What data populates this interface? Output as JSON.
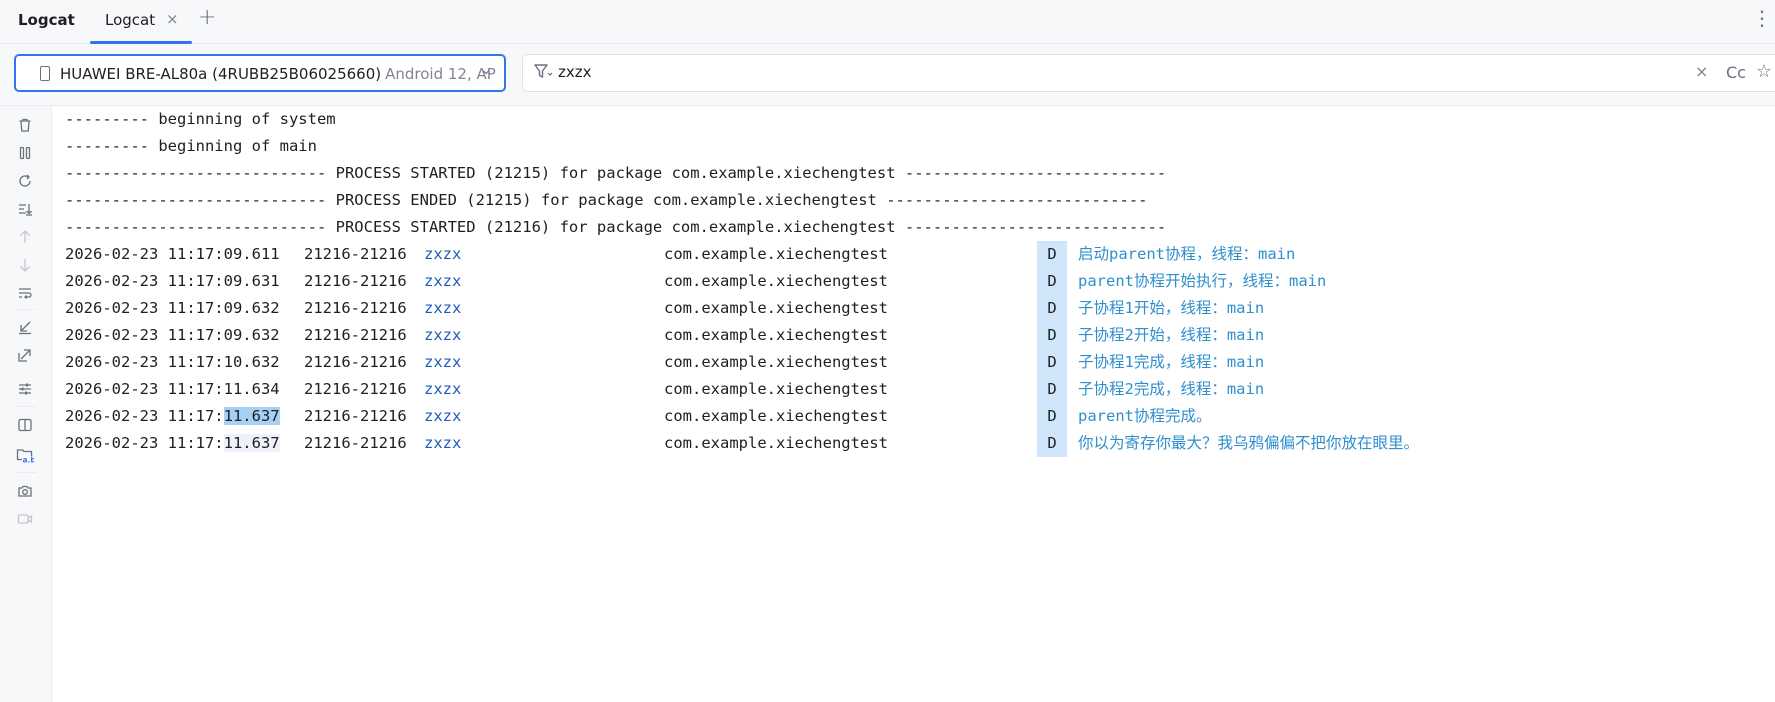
{
  "header": {
    "tool_title": "Logcat",
    "tab_label": "Logcat",
    "tab_close": "×",
    "add_tab": "+",
    "more_menu": "⋮"
  },
  "device": {
    "name": "HUAWEI BRE-AL80a (4RUBB25B06025660)",
    "os": "Android 12, AP",
    "chevron": "⌄"
  },
  "filter": {
    "value": "zxzx",
    "clear": "×",
    "case_label": "Cc",
    "star": "☆"
  },
  "sidebar": {
    "icons": [
      "trash-icon",
      "pause-icon",
      "restart-icon",
      "scroll-to-end-icon",
      "up-arrow-icon",
      "down-arrow-icon",
      "soft-wrap-icon",
      "import-icon",
      "export-icon",
      "settings-icon",
      "split-view-icon",
      "folder-regex-icon",
      "screenshot-icon",
      "screen-record-icon"
    ]
  },
  "log": {
    "headers": [
      "--------- beginning of system",
      "--------- beginning of main",
      "---------------------------- PROCESS STARTED (21215) for package com.example.xiechengtest ----------------------------",
      "---------------------------- PROCESS ENDED (21215) for package com.example.xiechengtest ----------------------------",
      "---------------------------- PROCESS STARTED (21216) for package com.example.xiechengtest ----------------------------"
    ],
    "entries": [
      {
        "ts_prefix": "2026-02-23 11:17:",
        "ts_suffix": "09.611",
        "pid": "21216-21216",
        "tag": "zxzx",
        "pkg": "com.example.xiechengtest",
        "level": "D",
        "msg": "启动parent协程，线程：main"
      },
      {
        "ts_prefix": "2026-02-23 11:17:",
        "ts_suffix": "09.631",
        "pid": "21216-21216",
        "tag": "zxzx",
        "pkg": "com.example.xiechengtest",
        "level": "D",
        "msg": "parent协程开始执行，线程：main"
      },
      {
        "ts_prefix": "2026-02-23 11:17:",
        "ts_suffix": "09.632",
        "pid": "21216-21216",
        "tag": "zxzx",
        "pkg": "com.example.xiechengtest",
        "level": "D",
        "msg": "子协程1开始，线程：main"
      },
      {
        "ts_prefix": "2026-02-23 11:17:",
        "ts_suffix": "09.632",
        "pid": "21216-21216",
        "tag": "zxzx",
        "pkg": "com.example.xiechengtest",
        "level": "D",
        "msg": "子协程2开始，线程：main"
      },
      {
        "ts_prefix": "2026-02-23 11:17:",
        "ts_suffix": "10.632",
        "pid": "21216-21216",
        "tag": "zxzx",
        "pkg": "com.example.xiechengtest",
        "level": "D",
        "msg": "子协程1完成，线程：main"
      },
      {
        "ts_prefix": "2026-02-23 11:17:",
        "ts_suffix": "11.634",
        "pid": "21216-21216",
        "tag": "zxzx",
        "pkg": "com.example.xiechengtest",
        "level": "D",
        "msg": "子协程2完成，线程：main"
      },
      {
        "ts_prefix": "2026-02-23 11:17:",
        "ts_suffix": "11.637",
        "pid": "21216-21216",
        "tag": "zxzx",
        "pkg": "com.example.xiechengtest",
        "level": "D",
        "msg": "parent协程完成。"
      },
      {
        "ts_prefix": "2026-02-23 11:17:",
        "ts_suffix": "11.637",
        "pid": "21216-21216",
        "tag": "zxzx",
        "pkg": "com.example.xiechengtest",
        "level": "D",
        "msg": "你以为寄存你最大？我乌鸦偏偏不把你放在眼里。"
      }
    ]
  }
}
